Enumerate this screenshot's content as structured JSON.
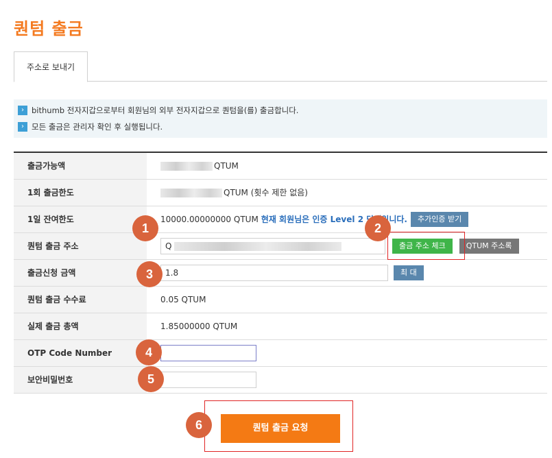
{
  "page": {
    "title": "퀀텀 출금"
  },
  "tabs": [
    {
      "label": "주소로 보내기",
      "active": true
    }
  ],
  "notices": [
    "bithumb 전자지갑으로부터 회원님의 외부 전자지갑으로 퀀텀을(를) 출금합니다.",
    "모든 출금은 관리자 확인 후 실행됩니다."
  ],
  "form": {
    "available": {
      "label": "출금가능액",
      "unit": "QTUM"
    },
    "single_limit": {
      "label": "1회 출금한도",
      "unit": "QTUM (횟수 제한 없음)"
    },
    "daily_limit": {
      "label": "1일 잔여한도",
      "amount": "10000.00000000 QTUM",
      "level_text": "현재 회원님은 인증 Level 2 단계입니다.",
      "button": "추가인증 받기"
    },
    "address": {
      "label": "퀀텀 출금 주소",
      "value_prefix": "Q",
      "check_button": "출금 주소 체크",
      "book_button": "QTUM 주소록"
    },
    "amount": {
      "label": "출금신청 금액",
      "value": "1.8",
      "max_button": "최 대"
    },
    "fee": {
      "label": "퀀텀 출금 수수료",
      "value": "0.05 QTUM"
    },
    "total": {
      "label": "실제 출금 총액",
      "value": "1.85000000 QTUM"
    },
    "otp": {
      "label": "OTP Code Number",
      "value": ""
    },
    "password": {
      "label": "보안비밀번호",
      "value": ""
    }
  },
  "submit_button": "퀀텀 출금 요청",
  "markers": [
    "1",
    "2",
    "3",
    "4",
    "5",
    "6"
  ],
  "colors": {
    "accent": "#f47a20",
    "marker": "#d9643d",
    "highlight_border": "#e02424",
    "check_button": "#3fb549",
    "action_button": "#5a87ad"
  }
}
